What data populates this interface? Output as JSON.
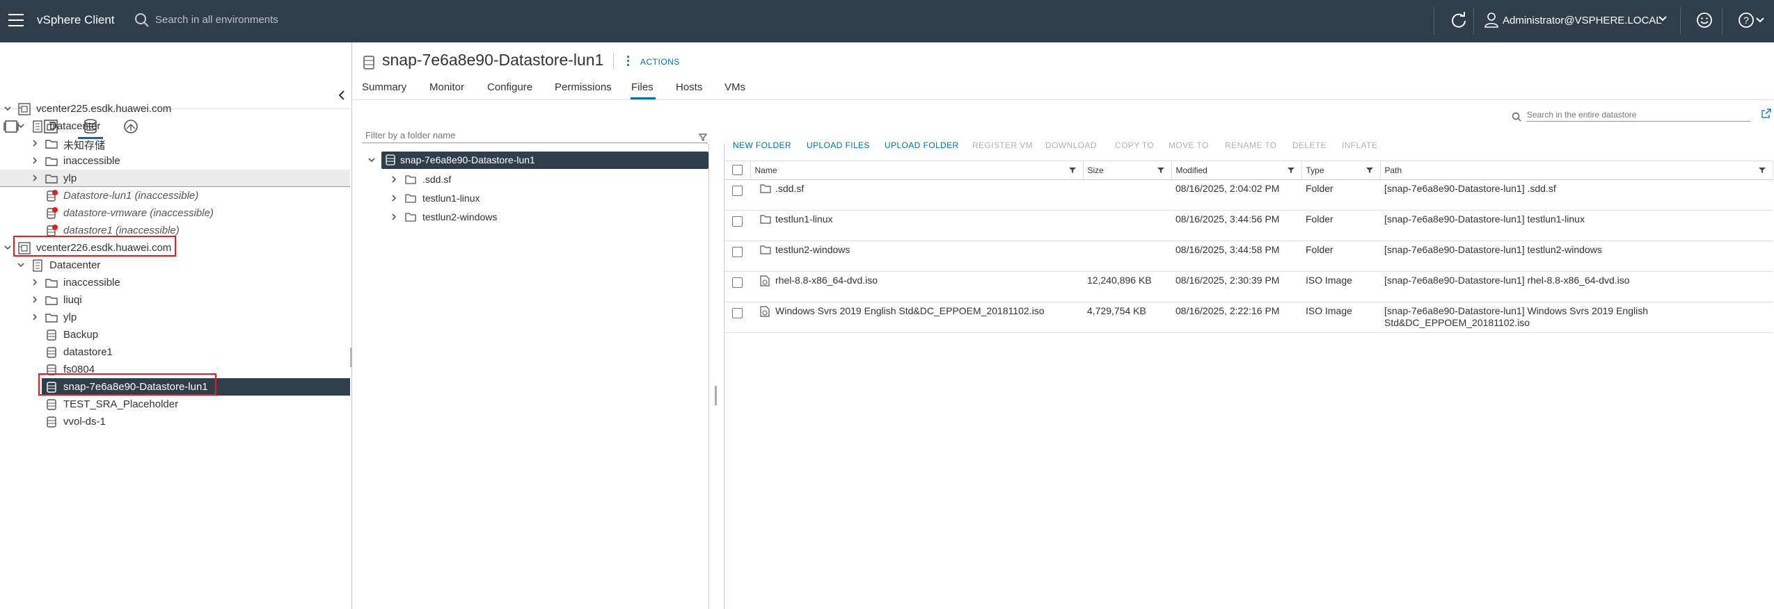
{
  "header": {
    "app_title": "vSphere Client",
    "search_placeholder": "Search in all environments",
    "user": "Administrator@VSPHERE.LOCAL",
    "icons": [
      "menu-icon",
      "search-icon",
      "refresh-icon",
      "user-icon",
      "smiley-icon",
      "help-icon"
    ]
  },
  "navigator": {
    "tree": [
      {
        "label": "vcenter225.esdk.huawei.com",
        "kind": "vcenter",
        "expanded": true
      },
      {
        "label": "Datacenter",
        "kind": "datacenter",
        "expanded": true
      },
      {
        "label": "未知存储",
        "kind": "folder"
      },
      {
        "label": "inaccessible",
        "kind": "folder"
      },
      {
        "label": "ylp",
        "kind": "folder"
      },
      {
        "label": "Datastore-lun1 (inaccessible)",
        "kind": "datastore-error"
      },
      {
        "label": "datastore-vmware (inaccessible)",
        "kind": "datastore-error"
      },
      {
        "label": "datastore1 (inaccessible)",
        "kind": "datastore-error"
      },
      {
        "label": "vcenter226.esdk.huawei.com",
        "kind": "vcenter",
        "expanded": true
      },
      {
        "label": "Datacenter",
        "kind": "datacenter",
        "expanded": true
      },
      {
        "label": "inaccessible",
        "kind": "folder"
      },
      {
        "label": "liuqi",
        "kind": "folder"
      },
      {
        "label": "ylp",
        "kind": "folder"
      },
      {
        "label": "Backup",
        "kind": "datastore"
      },
      {
        "label": "datastore1",
        "kind": "datastore"
      },
      {
        "label": "fs0804",
        "kind": "datastore"
      },
      {
        "label": "snap-7e6a8e90-Datastore-lun1",
        "kind": "datastore"
      },
      {
        "label": "TEST_SRA_Placeholder",
        "kind": "datastore"
      },
      {
        "label": "vvol-ds-1",
        "kind": "datastore"
      }
    ]
  },
  "object": {
    "title": "snap-7e6a8e90-Datastore-lun1",
    "actions_label": "ACTIONS",
    "tabs": [
      "Summary",
      "Monitor",
      "Configure",
      "Permissions",
      "Files",
      "Hosts",
      "VMs"
    ],
    "active_tab": "Files"
  },
  "files": {
    "filter_placeholder": "Filter by a folder name",
    "folder_tree": {
      "root": "snap-7e6a8e90-Datastore-lun1",
      "children": [
        ".sdd.sf",
        "testlun1-linux",
        "testlun2-windows"
      ]
    },
    "datastore_search_placeholder": "Search in the entire datastore",
    "toolbar": [
      {
        "label": "NEW FOLDER",
        "enabled": true
      },
      {
        "label": "UPLOAD FILES",
        "enabled": true
      },
      {
        "label": "UPLOAD FOLDER",
        "enabled": true
      },
      {
        "label": "REGISTER VM",
        "enabled": false
      },
      {
        "label": "DOWNLOAD",
        "enabled": false
      },
      {
        "label": "COPY TO",
        "enabled": false
      },
      {
        "label": "MOVE TO",
        "enabled": false
      },
      {
        "label": "RENAME TO",
        "enabled": false
      },
      {
        "label": "DELETE",
        "enabled": false
      },
      {
        "label": "INFLATE",
        "enabled": false
      }
    ],
    "columns": [
      "Name",
      "Size",
      "Modified",
      "Type",
      "Path"
    ],
    "rows": [
      {
        "name": ".sdd.sf",
        "size": "",
        "modified": "08/16/2025, 2:04:02 PM",
        "type": "Folder",
        "path": "[snap-7e6a8e90-Datastore-lun1] .sdd.sf",
        "icon": "folder-icon"
      },
      {
        "name": "testlun1-linux",
        "size": "",
        "modified": "08/16/2025, 3:44:56 PM",
        "type": "Folder",
        "path": "[snap-7e6a8e90-Datastore-lun1] testlun1-linux",
        "icon": "folder-icon"
      },
      {
        "name": "testlun2-windows",
        "size": "",
        "modified": "08/16/2025, 3:44:58 PM",
        "type": "Folder",
        "path": "[snap-7e6a8e90-Datastore-lun1] testlun2-windows",
        "icon": "folder-icon"
      },
      {
        "name": "rhel-8.8-x86_64-dvd.iso",
        "size": "12,240,896 KB",
        "modified": "08/16/2025, 2:30:39 PM",
        "type": "ISO Image",
        "path": "[snap-7e6a8e90-Datastore-lun1] rhel-8.8-x86_64-dvd.iso",
        "icon": "iso-file-icon"
      },
      {
        "name": "Windows Svrs 2019 English Std&DC_EPPOEM_20181102.iso",
        "size": "4,729,754 KB",
        "modified": "08/16/2025, 2:22:16 PM",
        "type": "ISO Image",
        "path": "[snap-7e6a8e90-Datastore-lun1] Windows Svrs 2019 English Std&DC_EPPOEM_20181102.iso",
        "icon": "iso-file-icon"
      }
    ]
  },
  "colors": {
    "header_bg": "#2f3e4a",
    "accent": "#0072a3",
    "highlight_box": "#e02020",
    "error_badge": "#e02020"
  }
}
